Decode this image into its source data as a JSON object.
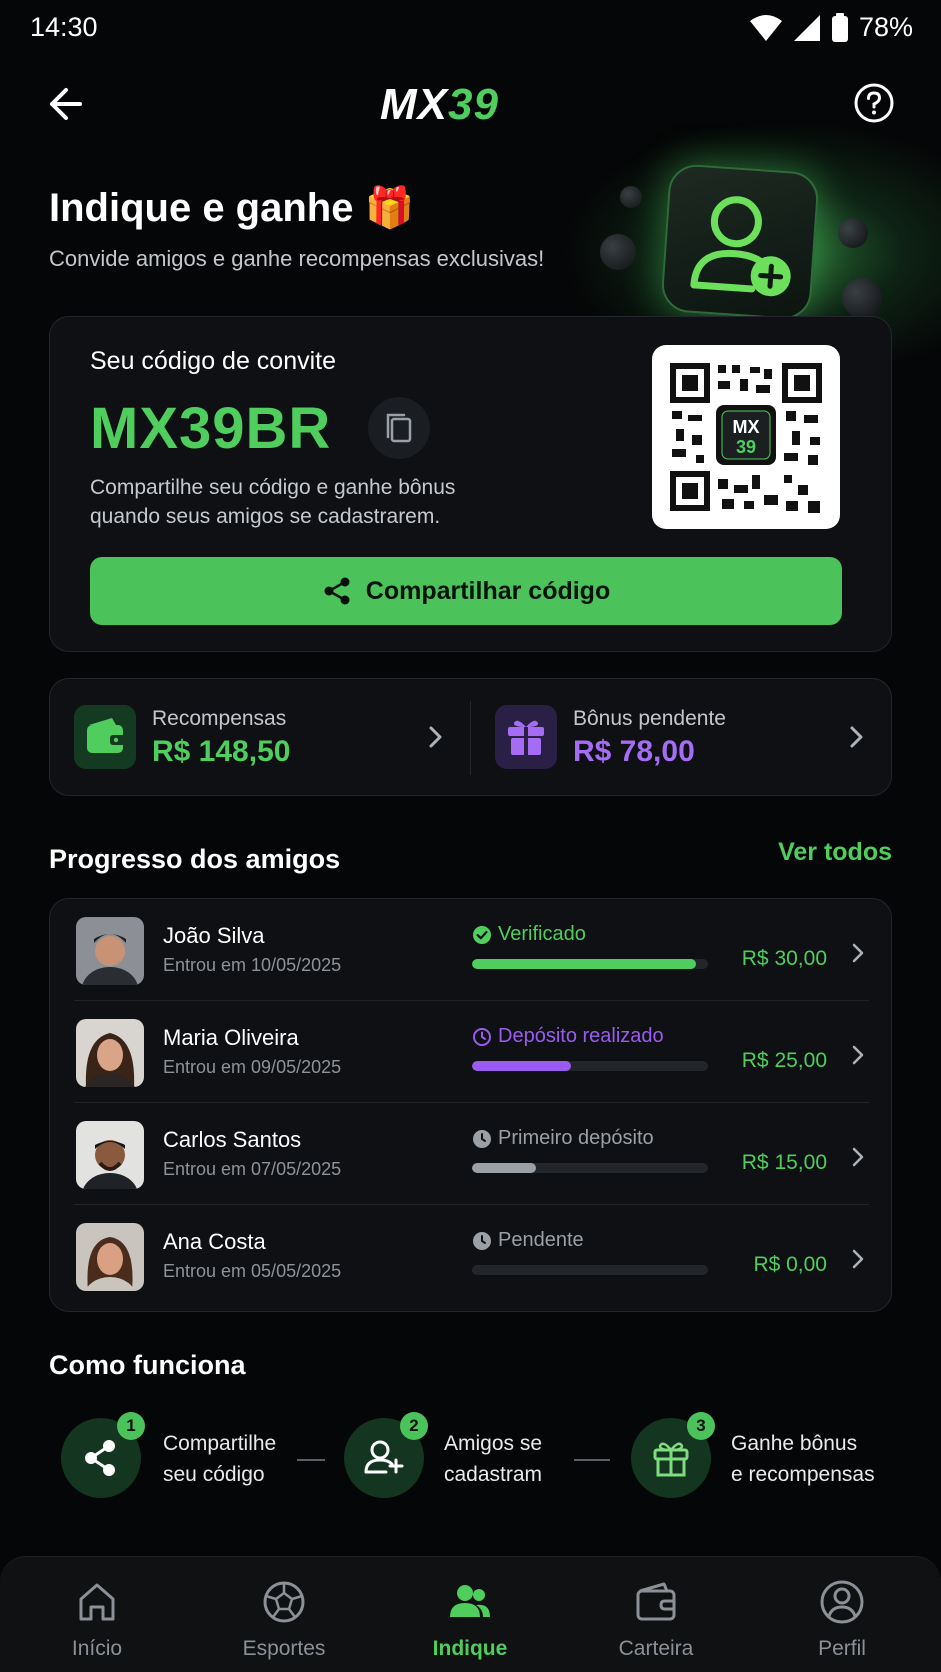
{
  "status_bar": {
    "time": "14:30",
    "battery": "78%"
  },
  "header": {
    "logo_left": "MX",
    "logo_right": "39",
    "back_icon": "arrow-left-icon",
    "help_icon": "help-circle-icon"
  },
  "hero": {
    "title": "Indique e ganhe",
    "title_emoji": "🎁",
    "subtitle": "Convide amigos e ganhe recompensas exclusivas!"
  },
  "invite": {
    "label": "Seu código de convite",
    "code": "MX39BR",
    "description": "Compartilhe seu código e ganhe bônus quando seus amigos se cadastrarem.",
    "qr_logo_top": "MX",
    "qr_logo_bottom": "39",
    "share_label": "Compartilhar código"
  },
  "rewards": {
    "earned": {
      "title": "Recompensas",
      "value": "R$ 148,50"
    },
    "pending": {
      "title": "Bônus pendente",
      "value": "R$ 78,00"
    }
  },
  "friends_section": {
    "title": "Progresso dos amigos",
    "see_all": "Ver todos"
  },
  "friends": [
    {
      "name": "João Silva",
      "joined": "Entrou em 10/05/2025",
      "status": "Verificado",
      "status_color": "#4fce5d",
      "progress": 0.95,
      "amount": "R$ 30,00",
      "icon": "check-circle-icon"
    },
    {
      "name": "Maria Oliveira",
      "joined": "Entrou em 09/05/2025",
      "status": "Depósito realizado",
      "status_color": "#9a5cf0",
      "progress": 0.42,
      "amount": "R$ 25,00",
      "icon": "clock-icon"
    },
    {
      "name": "Carlos Santos",
      "joined": "Entrou em 07/05/2025",
      "status": "Primeiro depósito",
      "status_color": "#9aa0a6",
      "progress": 0.27,
      "amount": "R$ 15,00",
      "icon": "clock-icon"
    },
    {
      "name": "Ana Costa",
      "joined": "Entrou em 05/05/2025",
      "status": "Pendente",
      "status_color": "#9aa0a6",
      "progress": 0.0,
      "amount": "R$ 0,00",
      "icon": "clock-icon"
    }
  ],
  "how_it_works": {
    "title": "Como funciona",
    "steps": [
      {
        "num": "1",
        "line1": "Compartilhe",
        "line2": "seu código",
        "icon": "share-icon"
      },
      {
        "num": "2",
        "line1": "Amigos se",
        "line2": "cadastram",
        "icon": "user-plus-icon"
      },
      {
        "num": "3",
        "line1": "Ganhe bônus",
        "line2": "e recompensas",
        "icon": "gift-icon"
      }
    ]
  },
  "nav": [
    {
      "label": "Início",
      "icon": "home-icon"
    },
    {
      "label": "Esportes",
      "icon": "soccer-ball-icon"
    },
    {
      "label": "Indique",
      "icon": "users-icon",
      "active": true
    },
    {
      "label": "Carteira",
      "icon": "wallet-icon"
    },
    {
      "label": "Perfil",
      "icon": "profile-icon"
    }
  ],
  "colors": {
    "accent": "#4fce5d",
    "purple": "#9a5cf0",
    "background": "#050607",
    "card": "#0e1013"
  }
}
